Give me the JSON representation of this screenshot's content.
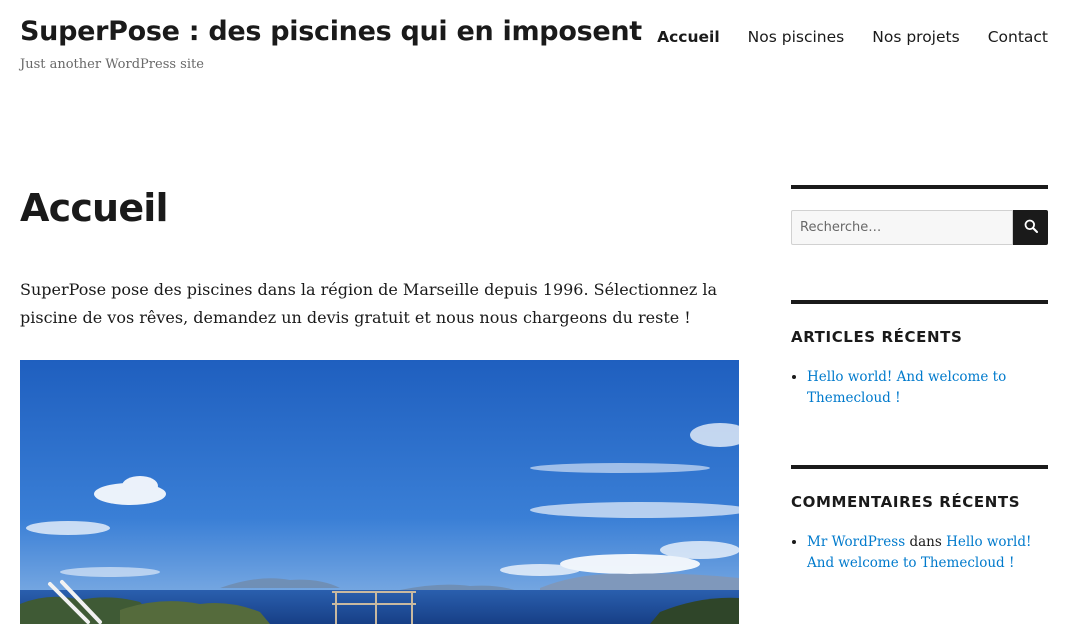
{
  "site": {
    "title": "SuperPose : des piscines qui en imposent",
    "description": "Just another WordPress site"
  },
  "nav": {
    "items": [
      {
        "label": "Accueil",
        "current": true
      },
      {
        "label": "Nos piscines",
        "current": false
      },
      {
        "label": "Nos projets",
        "current": false
      },
      {
        "label": "Contact",
        "current": false
      }
    ]
  },
  "main": {
    "title": "Accueil",
    "intro": "SuperPose pose des piscines dans la région de Marseille depuis 1996. Sélectionnez la piscine de vos rêves, demandez un devis gratuit et nous nous chargeons du reste !"
  },
  "sidebar": {
    "search": {
      "placeholder": "Recherche…",
      "button_icon": "search-icon"
    },
    "recent_posts": {
      "title": "ARTICLES RÉCENTS",
      "items": [
        {
          "label": "Hello world! And welcome to Themecloud !"
        }
      ]
    },
    "recent_comments": {
      "title": "COMMENTAIRES RÉCENTS",
      "items": [
        {
          "author": "Mr WordPress",
          "connector": "dans",
          "post": "Hello world! And welcome to Themecloud !"
        }
      ]
    }
  },
  "colors": {
    "text": "#1a1a1a",
    "link": "#007acc",
    "muted": "#686868",
    "sky": "#2f6fc8",
    "sea": "#1f4f9e"
  }
}
